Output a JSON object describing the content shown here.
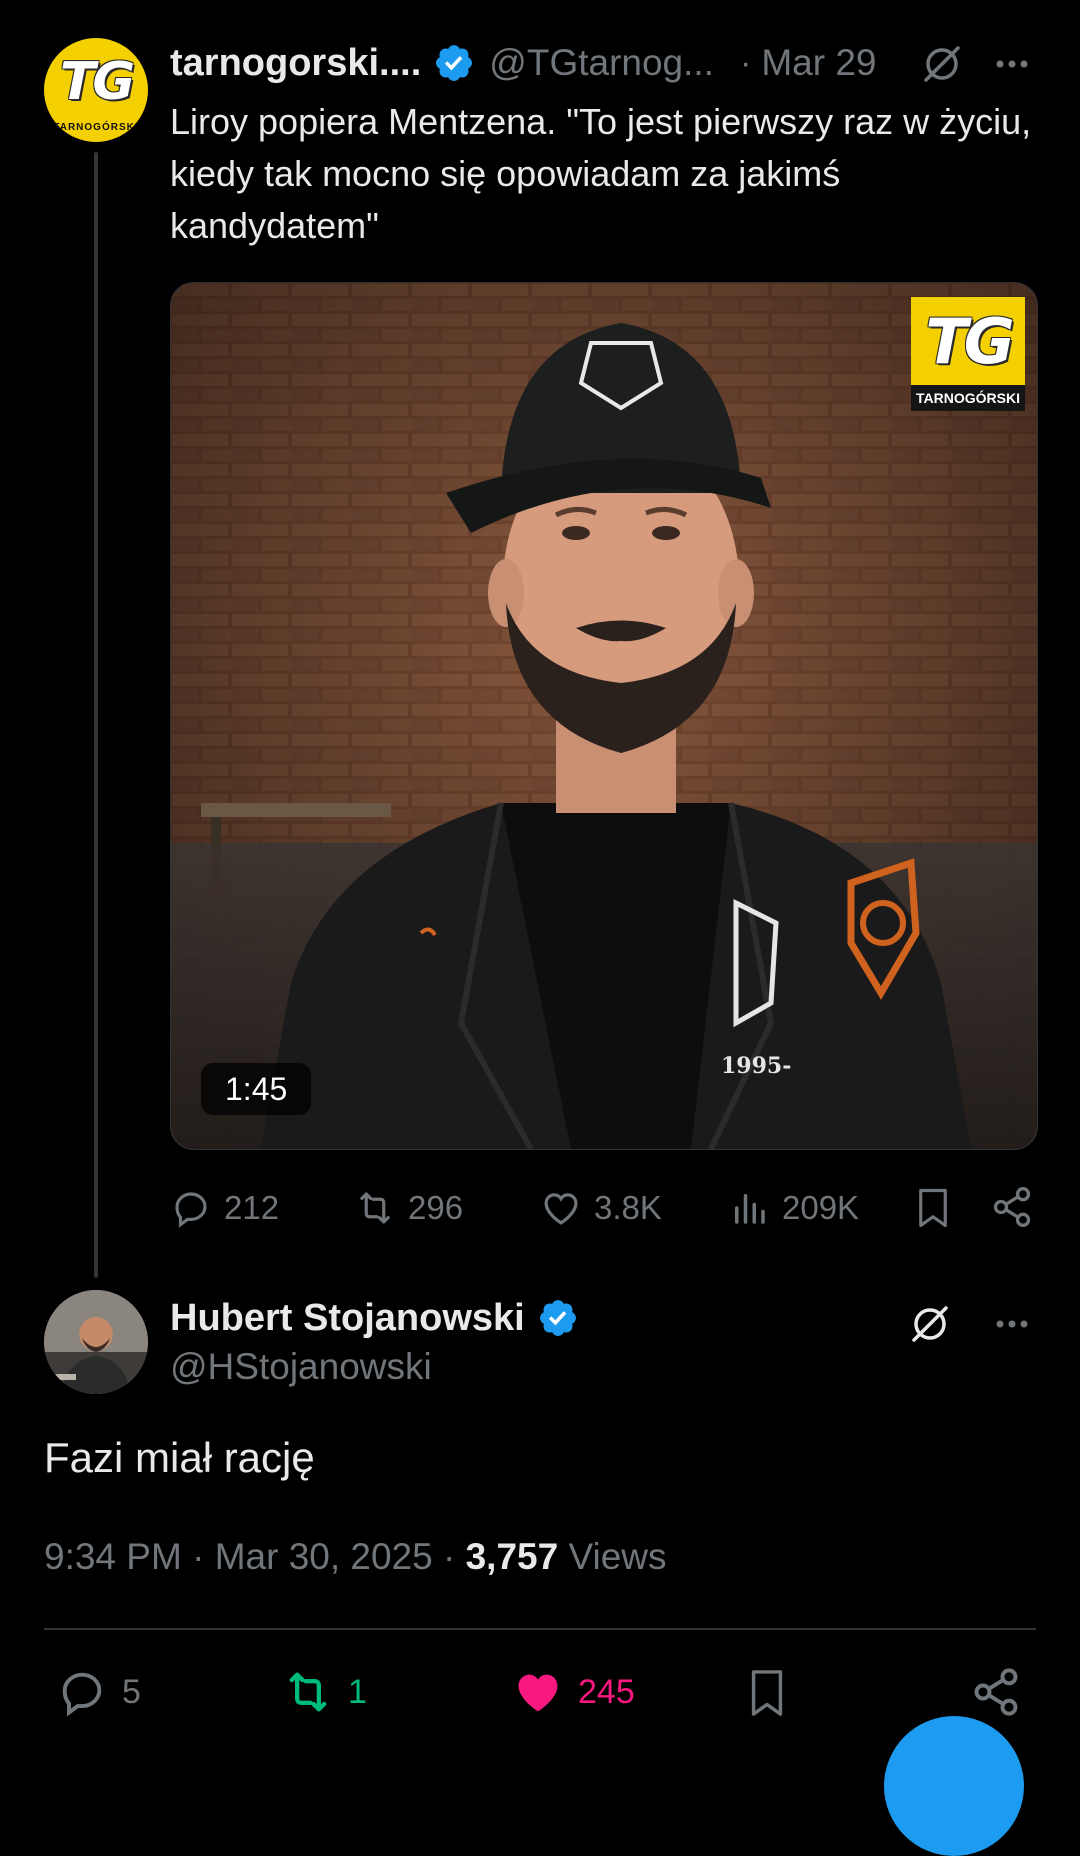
{
  "quoted_tweet": {
    "avatar_text": "TG",
    "avatar_subtext": "TARNOGÓRSKI",
    "display_name": "tarnogorski....",
    "handle": "@TGtarnog...",
    "separator": "·",
    "date": "Mar 29",
    "text": "Liroy popiera Mentzena. \"To jest pierwszy raz w życiu, kiedy tak mocno się opowiadam za jakimś kandydatem\"",
    "video": {
      "logo_text": "TG",
      "logo_brand": "TARNOGÓRSKI",
      "duration": "1:45",
      "icons": [
        "play-video"
      ]
    },
    "actions": {
      "replies": "212",
      "reposts": "296",
      "likes": "3.8K",
      "views": "209K"
    }
  },
  "main_tweet": {
    "display_name": "Hubert Stojanowski",
    "handle": "@HStojanowski",
    "text": "Fazi miał rację",
    "time": "9:34 PM",
    "separator": "·",
    "date": "Mar 30, 2025",
    "separator2": "·",
    "views_count": "3,757",
    "views_label": "Views",
    "actions": {
      "replies": "5",
      "reposts": "1",
      "likes": "245"
    }
  },
  "colors": {
    "background": "#000000",
    "text_primary": "#e7e9ea",
    "text_secondary": "#71767b",
    "verified_blue": "#1d9bf0",
    "repost_green": "#00ba7c",
    "like_pink": "#f91880",
    "brand_yellow": "#f4d000"
  },
  "icons": [
    "verified-badge",
    "grok-icon",
    "more-icon",
    "reply-icon",
    "repost-icon",
    "like-icon",
    "views-icon",
    "bookmark-icon",
    "share-icon"
  ]
}
